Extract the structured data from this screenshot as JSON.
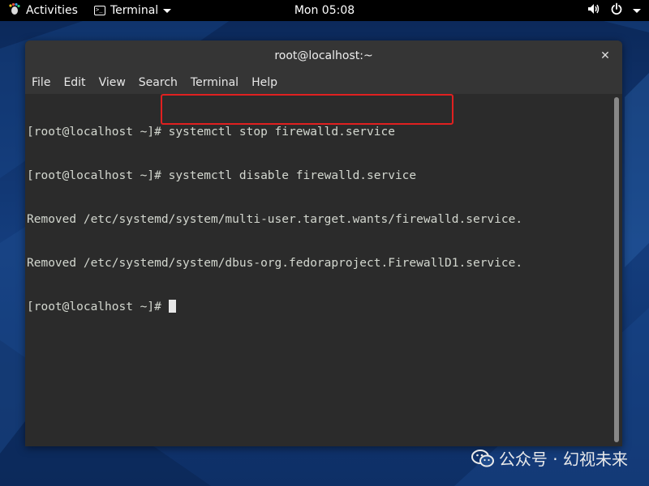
{
  "topbar": {
    "activities_label": "Activities",
    "app_label": "Terminal",
    "clock": "Mon 05:08"
  },
  "window": {
    "title": "root@localhost:~",
    "close_glyph": "✕",
    "menu": [
      "File",
      "Edit",
      "View",
      "Search",
      "Terminal",
      "Help"
    ]
  },
  "terminal": {
    "lines": [
      "[root@localhost ~]# systemctl stop firewalld.service",
      "[root@localhost ~]# systemctl disable firewalld.service",
      "Removed /etc/systemd/system/multi-user.target.wants/firewalld.service.",
      "Removed /etc/systemd/system/dbus-org.fedoraproject.FirewallD1.service.",
      "[root@localhost ~]# "
    ]
  },
  "watermark": {
    "text": "公众号 · 幻视未来"
  },
  "icons": {
    "activities": "gnome-foot-icon",
    "app": "terminal-icon",
    "volume": "volume-icon",
    "power": "power-icon",
    "caret": "chevron-down-icon",
    "close": "close-icon"
  },
  "colors": {
    "highlight": "#e02020",
    "terminal_bg": "#2b2b2b",
    "terminal_fg": "#d3d7cf",
    "topbar_bg": "#000000"
  }
}
